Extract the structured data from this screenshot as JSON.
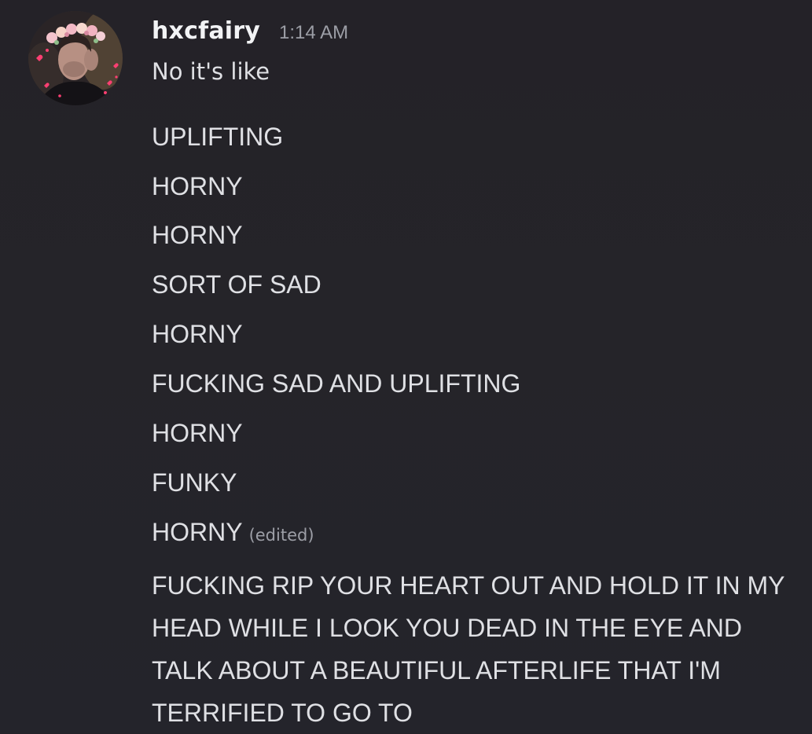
{
  "message": {
    "username": "hxcfairy",
    "timestamp": "1:14 AM",
    "first_line": "No it's like",
    "lines": [
      "UPLIFTING",
      "HORNY",
      "HORNY",
      "SORT OF SAD",
      "HORNY",
      "FUCKING SAD AND UPLIFTING",
      "HORNY",
      "FUNKY",
      "HORNY"
    ],
    "edited_label": "(edited)",
    "final_line": "FUCKING RIP YOUR HEART OUT AND HOLD IT IN MY HEAD WHILE I LOOK YOU DEAD IN THE EYE AND TALK ABOUT A BEAUTIFUL AFTERLIFE THAT I'M TERRIFIED TO GO TO"
  },
  "avatar": {
    "icon": "avatar-flower-crown",
    "accent_colors": [
      "#f2b8c4",
      "#e06f8e",
      "#ff4d7a"
    ]
  },
  "colors": {
    "background": "#242229",
    "username": "#f2f3f5",
    "timestamp": "#9c9ea6",
    "text": "#dfe0e4"
  }
}
